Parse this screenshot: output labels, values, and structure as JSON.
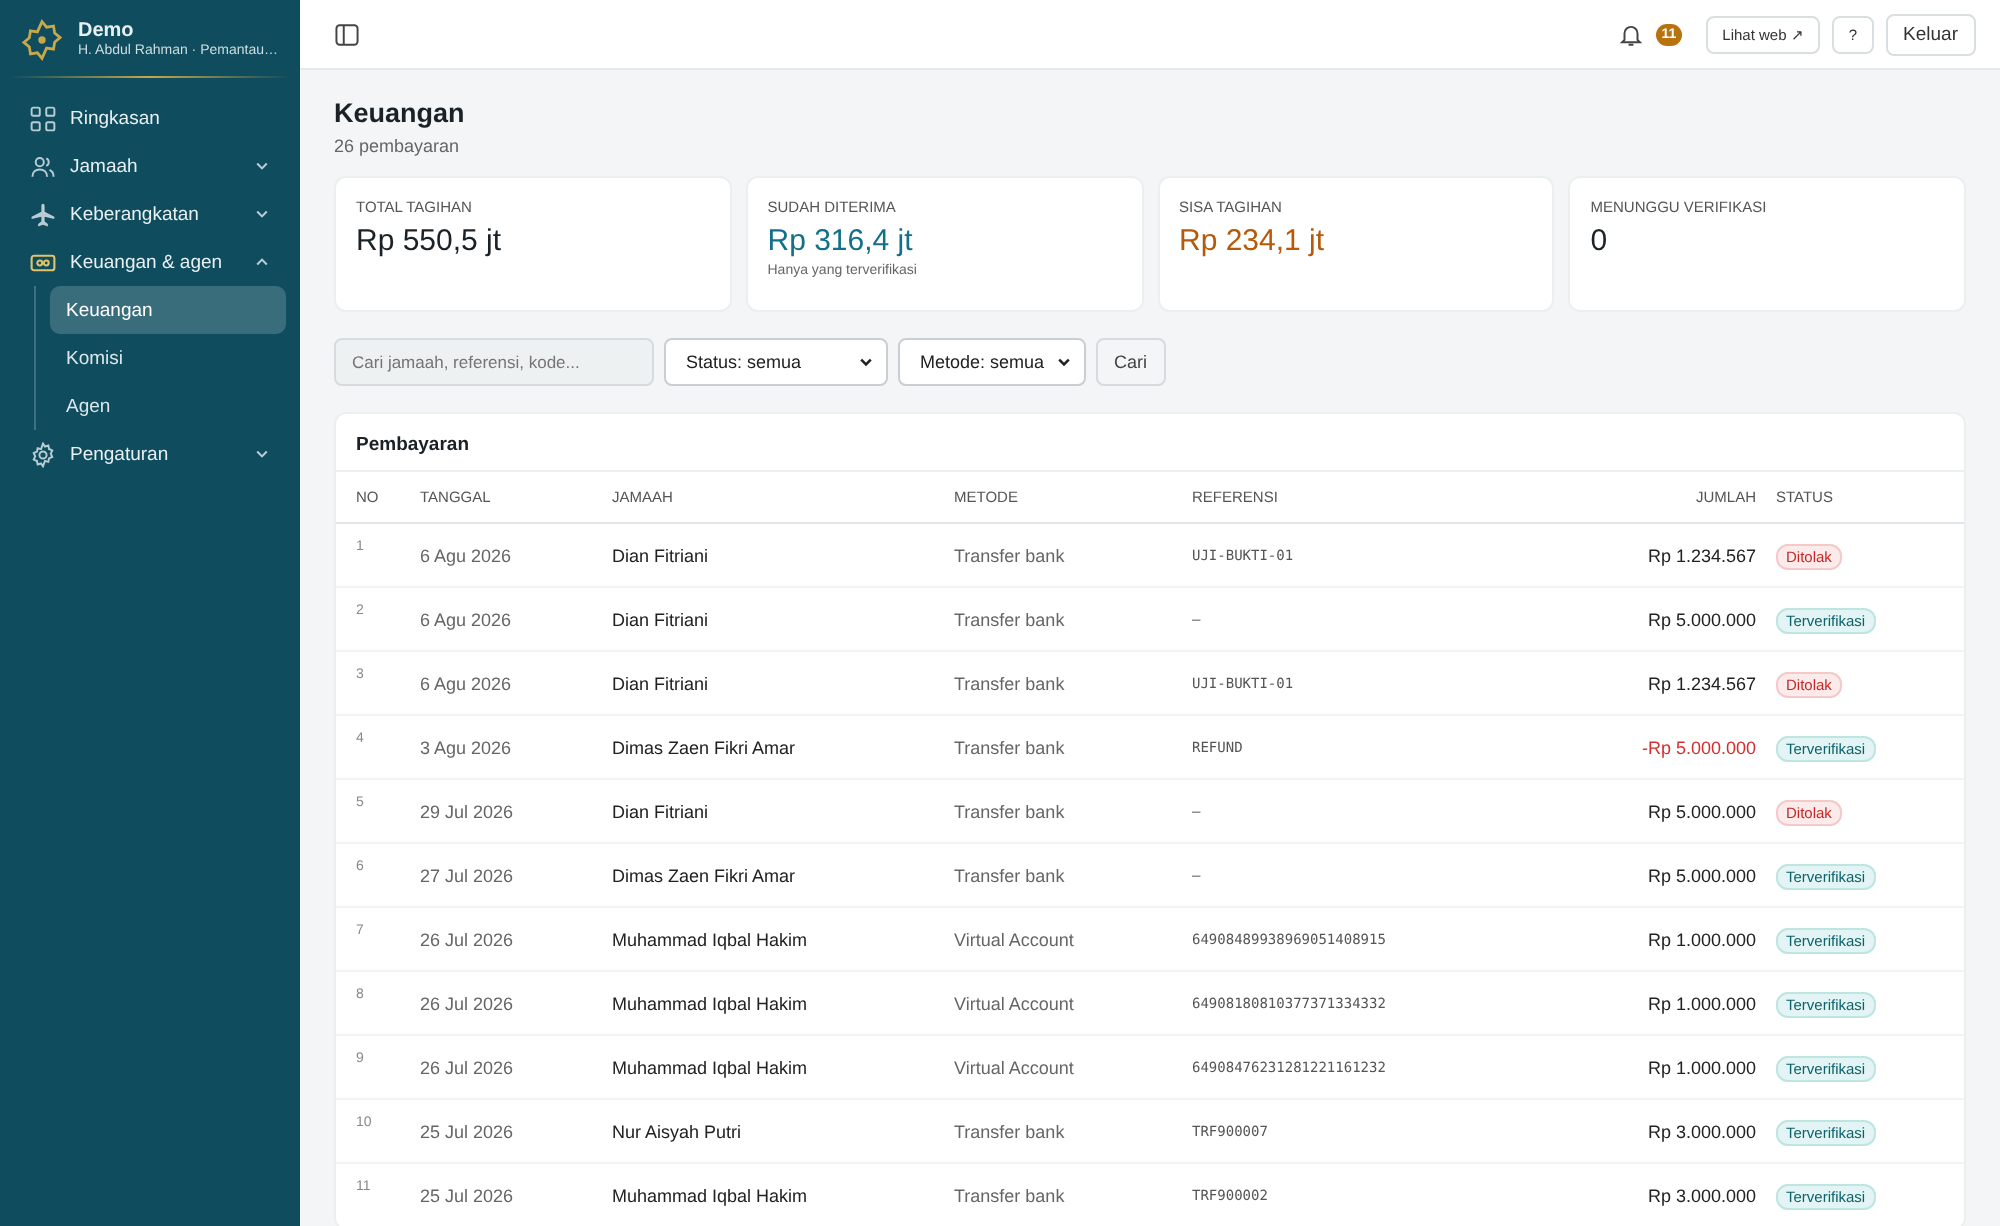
{
  "brand": {
    "title": "Demo",
    "subtitle": "H. Abdul Rahman · Pemantau…"
  },
  "sidebar": {
    "items": [
      {
        "label": "Ringkasan",
        "selected": false
      },
      {
        "label": "Jamaah",
        "expanded": false,
        "selected": false
      },
      {
        "label": "Keberangkatan",
        "expanded": false,
        "selected": false
      },
      {
        "label": "Keuangan & agen",
        "expanded": true,
        "selected": false,
        "children": [
          {
            "label": "Keuangan",
            "selected": true
          },
          {
            "label": "Komisi",
            "selected": false
          },
          {
            "label": "Agen",
            "selected": false
          }
        ]
      },
      {
        "label": "Pengaturan",
        "expanded": false,
        "selected": false
      }
    ]
  },
  "topbar": {
    "notification_count": "11",
    "buttons": [
      {
        "label": "Lihat web ↗"
      },
      {
        "label": "?"
      },
      {
        "label": "Keluar"
      }
    ]
  },
  "page": {
    "title": "Keuangan",
    "subtitle": "26 pembayaran"
  },
  "cards": [
    {
      "label": "TOTAL TAGIHAN",
      "value": "Rp 550,5 jt",
      "color": "#1b2227"
    },
    {
      "label": "SUDAH DITERIMA",
      "value": "Rp 316,4 jt",
      "color": "#137088",
      "note": "Hanya yang terverifikasi"
    },
    {
      "label": "SISA TAGIHAN",
      "value": "Rp 234,1 jt",
      "color": "#b45a0a"
    },
    {
      "label": "MENUNGGU VERIFIKASI",
      "value": "0",
      "color": "#1b2227"
    }
  ],
  "filters": {
    "search": {
      "placeholder": "Cari jamaah, referensi, kode..."
    },
    "selects": [
      "Status: semua",
      "Metode: semua"
    ],
    "button": "Cari"
  },
  "table": {
    "title": "Pembayaran",
    "columns": [
      "NO",
      "TANGGAL",
      "JAMAAH",
      "METODE",
      "REFERENSI",
      "JUMLAH",
      "STATUS"
    ],
    "rows": [
      {
        "no": "1",
        "date": "6 Agu 2026",
        "name": "Dian Fitriani",
        "method": "Transfer bank",
        "ref": "UJI-BUKTI-01",
        "amount": "Rp 1.234.567",
        "negative": false,
        "status": "Ditolak",
        "kind": "rejected"
      },
      {
        "no": "2",
        "date": "6 Agu 2026",
        "name": "Dian Fitriani",
        "method": "Transfer bank",
        "ref": "–",
        "amount": "Rp 5.000.000",
        "negative": false,
        "status": "Terverifikasi",
        "kind": "verified"
      },
      {
        "no": "3",
        "date": "6 Agu 2026",
        "name": "Dian Fitriani",
        "method": "Transfer bank",
        "ref": "UJI-BUKTI-01",
        "amount": "Rp 1.234.567",
        "negative": false,
        "status": "Ditolak",
        "kind": "rejected"
      },
      {
        "no": "4",
        "date": "3 Agu 2026",
        "name": "Dimas Zaen Fikri Amar",
        "method": "Transfer bank",
        "ref": "REFUND",
        "amount": "-Rp 5.000.000",
        "negative": true,
        "status": "Terverifikasi",
        "kind": "verified"
      },
      {
        "no": "5",
        "date": "29 Jul 2026",
        "name": "Dian Fitriani",
        "method": "Transfer bank",
        "ref": "–",
        "amount": "Rp 5.000.000",
        "negative": false,
        "status": "Ditolak",
        "kind": "rejected"
      },
      {
        "no": "6",
        "date": "27 Jul 2026",
        "name": "Dimas Zaen Fikri Amar",
        "method": "Transfer bank",
        "ref": "–",
        "amount": "Rp 5.000.000",
        "negative": false,
        "status": "Terverifikasi",
        "kind": "verified"
      },
      {
        "no": "7",
        "date": "26 Jul 2026",
        "name": "Muhammad Iqbal Hakim",
        "method": "Virtual Account",
        "ref": "64908489938969051408915",
        "amount": "Rp 1.000.000",
        "negative": false,
        "status": "Terverifikasi",
        "kind": "verified"
      },
      {
        "no": "8",
        "date": "26 Jul 2026",
        "name": "Muhammad Iqbal Hakim",
        "method": "Virtual Account",
        "ref": "64908180810377371334332",
        "amount": "Rp 1.000.000",
        "negative": false,
        "status": "Terverifikasi",
        "kind": "verified"
      },
      {
        "no": "9",
        "date": "26 Jul 2026",
        "name": "Muhammad Iqbal Hakim",
        "method": "Virtual Account",
        "ref": "64908476231281221161232",
        "amount": "Rp 1.000.000",
        "negative": false,
        "status": "Terverifikasi",
        "kind": "verified"
      },
      {
        "no": "10",
        "date": "25 Jul 2026",
        "name": "Nur Aisyah Putri",
        "method": "Transfer bank",
        "ref": "TRF900007",
        "amount": "Rp 3.000.000",
        "negative": false,
        "status": "Terverifikasi",
        "kind": "verified"
      },
      {
        "no": "11",
        "date": "25 Jul 2026",
        "name": "Muhammad Iqbal Hakim",
        "method": "Transfer bank",
        "ref": "TRF900002",
        "amount": "Rp 3.000.000",
        "negative": false,
        "status": "Terverifikasi",
        "kind": "verified"
      }
    ]
  }
}
